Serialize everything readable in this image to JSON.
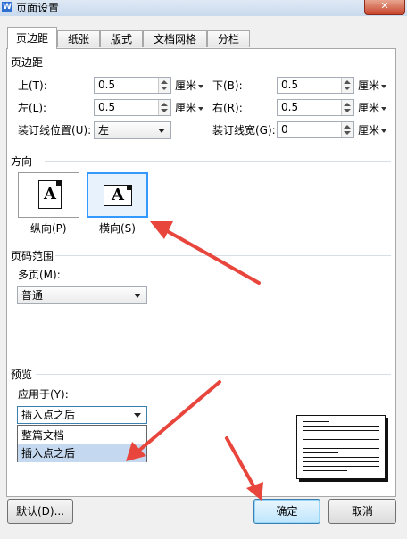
{
  "window": {
    "title": "页面设置",
    "app_icon": "W",
    "close_glyph": "✕"
  },
  "tabs": [
    {
      "label": "页边距",
      "active": true
    },
    {
      "label": "纸张"
    },
    {
      "label": "版式"
    },
    {
      "label": "文档网格"
    },
    {
      "label": "分栏"
    }
  ],
  "margins": {
    "section_title": "页边距",
    "top": {
      "label": "上(T):",
      "value": "0.5",
      "unit": "厘米"
    },
    "bottom": {
      "label": "下(B):",
      "value": "0.5",
      "unit": "厘米"
    },
    "left": {
      "label": "左(L):",
      "value": "0.5",
      "unit": "厘米"
    },
    "right": {
      "label": "右(R):",
      "value": "0.5",
      "unit": "厘米"
    },
    "gutter_pos": {
      "label": "装订线位置(U):",
      "value": "左"
    },
    "gutter_width": {
      "label": "装订线宽(G):",
      "value": "0",
      "unit": "厘米"
    }
  },
  "orientation": {
    "section_title": "方向",
    "portrait": {
      "label": "纵向(P)",
      "glyph": "A"
    },
    "landscape": {
      "label": "横向(S)",
      "glyph": "A",
      "selected": true
    }
  },
  "page_range": {
    "section_title": "页码范围",
    "multi_label": "多页(M):",
    "multi_value": "普通"
  },
  "preview": {
    "section_title": "预览",
    "apply_label": "应用于(Y):",
    "apply_value": "插入点之后",
    "options": [
      "整篇文档",
      "插入点之后"
    ],
    "highlighted_option": "插入点之后"
  },
  "buttons": {
    "default": "默认(D)...",
    "ok": "确定",
    "cancel": "取消"
  },
  "colors": {
    "accent": "#3399ff",
    "annotation_arrow": "#e8453c",
    "ok_button": "#bee6fd"
  }
}
